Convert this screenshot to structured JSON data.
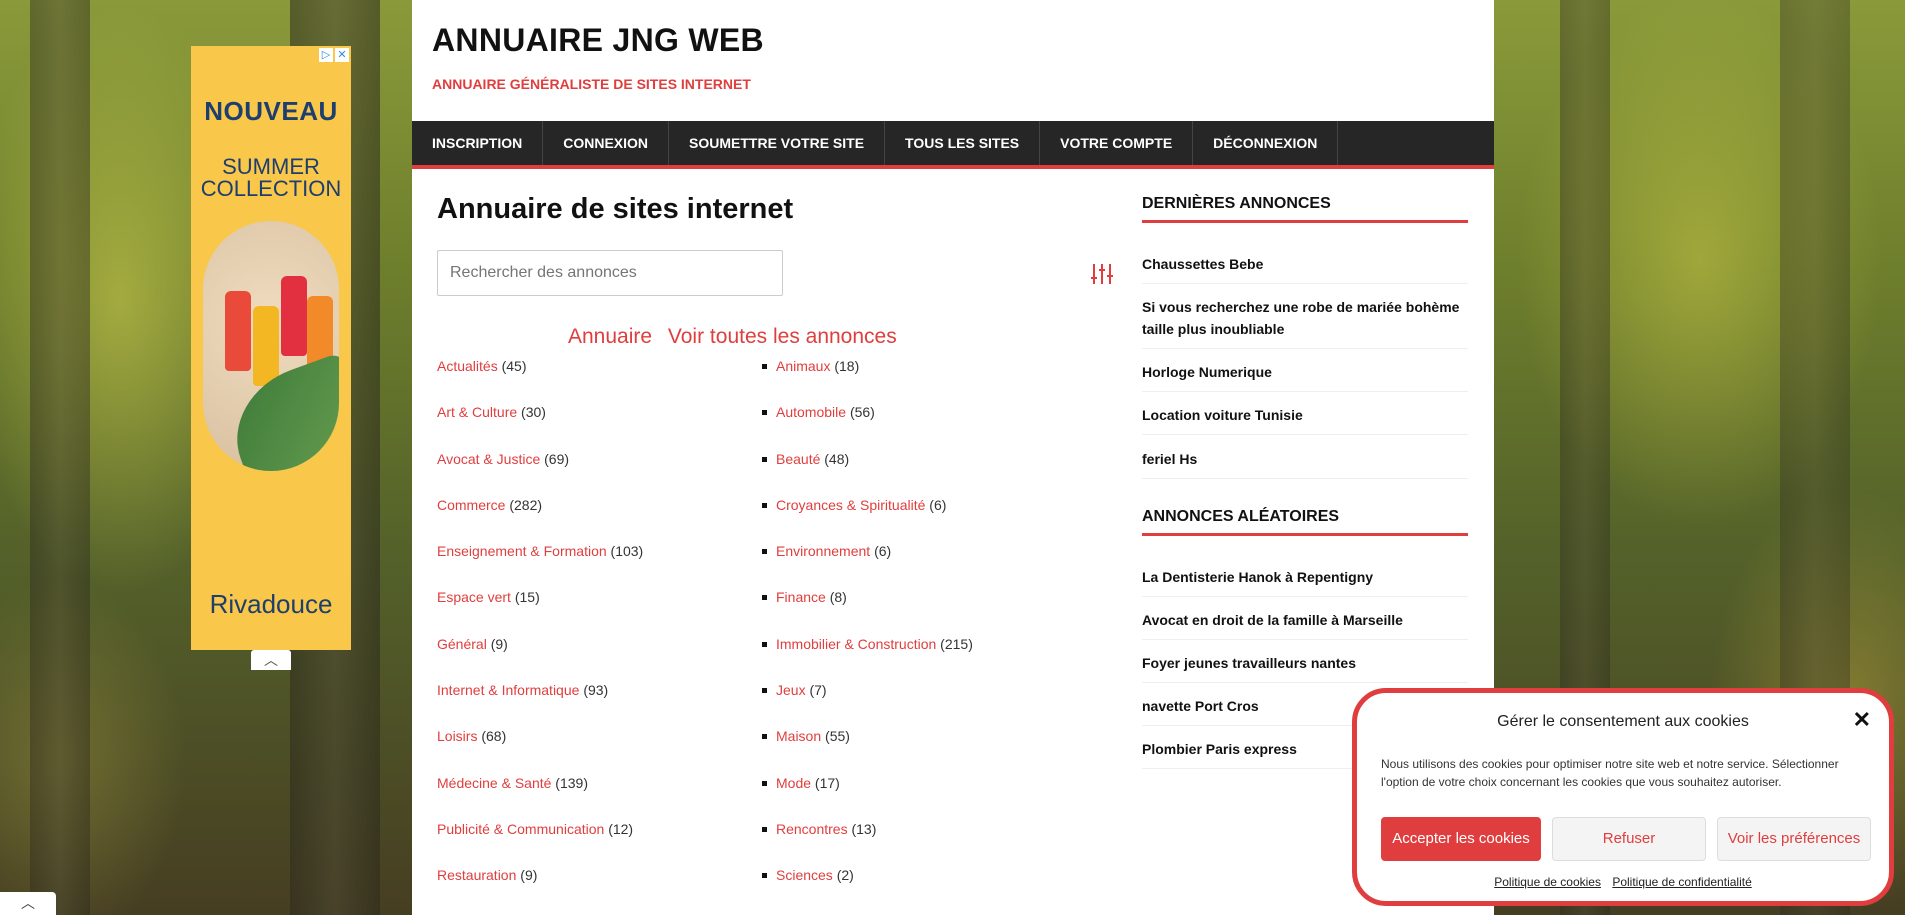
{
  "ad": {
    "title": "NOUVEAU",
    "subtitle_line1": "SUMMER",
    "subtitle_line2": "COLLECTION",
    "brand": "Rivadouce",
    "ad_choices_icon": "▷",
    "close_icon": "✕",
    "collapse_icon": "︿"
  },
  "site": {
    "title": "ANNUAIRE JNG WEB",
    "tagline": "ANNUAIRE GÉNÉRALISTE DE SITES INTERNET"
  },
  "nav": {
    "items": [
      "INSCRIPTION",
      "CONNEXION",
      "SOUMETTRE VOTRE SITE",
      "TOUS LES SITES",
      "VOTRE COMPTE",
      "DÉCONNEXION"
    ]
  },
  "main": {
    "heading": "Annuaire de sites internet",
    "search_placeholder": "Rechercher des annonces",
    "links": [
      "Annuaire",
      "Voir toutes les annonces"
    ],
    "categories_left": [
      {
        "name": "Actualités",
        "count": "(45)"
      },
      {
        "name": "Art & Culture",
        "count": "(30)"
      },
      {
        "name": "Avocat & Justice",
        "count": "(69)"
      },
      {
        "name": "Commerce",
        "count": "(282)"
      },
      {
        "name": "Enseignement & Formation",
        "count": "(103)"
      },
      {
        "name": "Espace vert",
        "count": "(15)"
      },
      {
        "name": "Général",
        "count": "(9)"
      },
      {
        "name": "Internet & Informatique",
        "count": "(93)"
      },
      {
        "name": "Loisirs",
        "count": "(68)"
      },
      {
        "name": "Médecine & Santé",
        "count": "(139)"
      },
      {
        "name": "Publicité & Communication",
        "count": "(12)"
      },
      {
        "name": "Restauration",
        "count": "(9)"
      }
    ],
    "categories_right": [
      {
        "name": "Animaux",
        "count": "(18)"
      },
      {
        "name": "Automobile",
        "count": "(56)"
      },
      {
        "name": "Beauté",
        "count": "(48)"
      },
      {
        "name": "Croyances & Spiritualité",
        "count": "(6)"
      },
      {
        "name": "Environnement",
        "count": "(6)"
      },
      {
        "name": "Finance",
        "count": "(8)"
      },
      {
        "name": "Immobilier & Construction",
        "count": "(215)"
      },
      {
        "name": "Jeux",
        "count": "(7)"
      },
      {
        "name": "Maison",
        "count": "(55)"
      },
      {
        "name": "Mode",
        "count": "(17)"
      },
      {
        "name": "Rencontres",
        "count": "(13)"
      },
      {
        "name": "Sciences",
        "count": "(2)"
      }
    ]
  },
  "sidebar": {
    "latest_title": "DERNIÈRES ANNONCES",
    "latest": [
      "Chaussettes Bebe",
      "Si vous recherchez une robe de mariée bohème taille plus inoubliable",
      "Horloge Numerique",
      "Location voiture Tunisie",
      "feriel Hs"
    ],
    "random_title": "ANNONCES ALÉATOIRES",
    "random": [
      "La Dentisterie Hanok à Repentigny",
      "Avocat en droit de la famille à Marseille",
      "Foyer jeunes travailleurs nantes",
      "navette Port Cros",
      "Plombier Paris express"
    ]
  },
  "cookie": {
    "title": "Gérer le consentement aux cookies",
    "close_icon": "✕",
    "text": "Nous utilisons des cookies pour optimiser notre site web et notre service. Sélectionner l'option de votre choix concernant les cookies que vous souhaitez autoriser.",
    "accept": "Accepter les cookies",
    "refuse": "Refuser",
    "prefs": "Voir les préférences",
    "link_cookies": "Politique de cookies",
    "link_privacy": "Politique de confidentialité"
  },
  "corner": {
    "collapse_icon": "︿"
  },
  "colors": {
    "accent": "#e03e3e",
    "nav_bg": "#262626"
  }
}
